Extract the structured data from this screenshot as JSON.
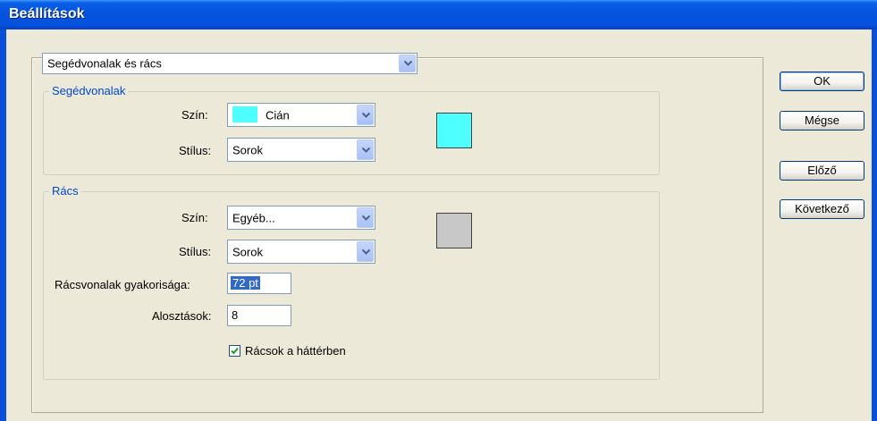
{
  "window": {
    "title": "Beállítások"
  },
  "section_select": {
    "value": "Segédvonalak és rács"
  },
  "guides": {
    "legend": "Segédvonalak",
    "color_label": "Szín:",
    "color_value": "Cián",
    "color_hex": "#4dffff",
    "style_label": "Stílus:",
    "style_value": "Sorok",
    "swatch_hex": "#4dffff"
  },
  "grid": {
    "legend": "Rács",
    "color_label": "Szín:",
    "color_value": "Egyéb...",
    "style_label": "Stílus:",
    "style_value": "Sorok",
    "swatch_hex": "#c8c8c8",
    "frequency_label": "Rácsvonalak gyakorisága:",
    "frequency_value": "72 pt",
    "subdivisions_label": "Alosztások:",
    "subdivisions_value": "8",
    "background_checkbox_label": "Rácsok a háttérben",
    "background_checked": true
  },
  "buttons": {
    "ok": "OK",
    "cancel": "Mégse",
    "previous": "Előző",
    "next": "Következő"
  }
}
